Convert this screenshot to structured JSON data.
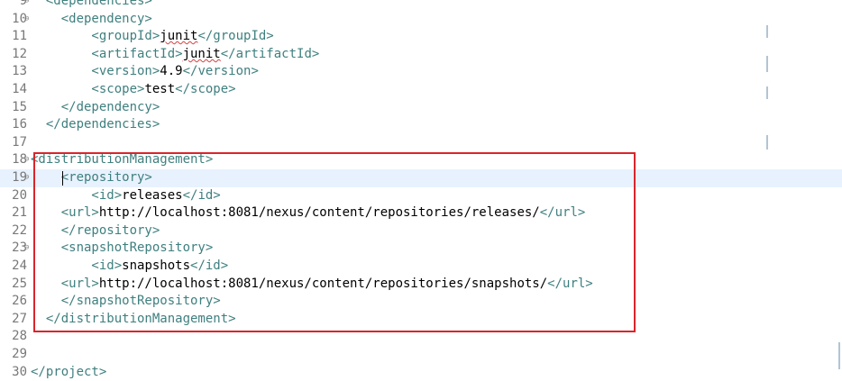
{
  "editor": {
    "lines": [
      {
        "num": "9",
        "fold": "⊖",
        "segments": [
          {
            "t": "tag",
            "v": "  <dependencies>"
          }
        ],
        "partial": true
      },
      {
        "num": "10",
        "fold": "⊖",
        "segments": [
          {
            "t": "tag",
            "v": "    <dependency>"
          }
        ]
      },
      {
        "num": "11",
        "segments": [
          {
            "t": "tag",
            "v": "        <groupId>"
          },
          {
            "t": "txt",
            "v": "junit",
            "squig": true
          },
          {
            "t": "tag",
            "v": "</groupId>"
          }
        ]
      },
      {
        "num": "12",
        "segments": [
          {
            "t": "tag",
            "v": "        <artifactId>"
          },
          {
            "t": "txt",
            "v": "junit",
            "squig": true
          },
          {
            "t": "tag",
            "v": "</artifactId>"
          }
        ]
      },
      {
        "num": "13",
        "segments": [
          {
            "t": "tag",
            "v": "        <version>"
          },
          {
            "t": "txt",
            "v": "4.9"
          },
          {
            "t": "tag",
            "v": "</version>"
          }
        ]
      },
      {
        "num": "14",
        "segments": [
          {
            "t": "tag",
            "v": "        <scope>"
          },
          {
            "t": "txt",
            "v": "test"
          },
          {
            "t": "tag",
            "v": "</scope>"
          }
        ]
      },
      {
        "num": "15",
        "segments": [
          {
            "t": "tag",
            "v": "    </dependency>"
          }
        ]
      },
      {
        "num": "16",
        "segments": [
          {
            "t": "tag",
            "v": "  </dependencies>"
          }
        ]
      },
      {
        "num": "17",
        "segments": []
      },
      {
        "num": "18",
        "fold": "⊖",
        "segments": [
          {
            "t": "tag",
            "v": "<distributionManagement>"
          }
        ]
      },
      {
        "num": "19",
        "fold": "⊖",
        "current": true,
        "segments": [
          {
            "t": "tag",
            "v": "    <repository>"
          }
        ]
      },
      {
        "num": "20",
        "segments": [
          {
            "t": "tag",
            "v": "        <id>"
          },
          {
            "t": "txt",
            "v": "releases"
          },
          {
            "t": "tag",
            "v": "</id>"
          }
        ]
      },
      {
        "num": "21",
        "segments": [
          {
            "t": "tag",
            "v": "    <url>"
          },
          {
            "t": "txt",
            "v": "http://localhost:8081/nexus/content/repositories/releases/"
          },
          {
            "t": "tag",
            "v": "</url>"
          }
        ]
      },
      {
        "num": "22",
        "segments": [
          {
            "t": "tag",
            "v": "    </repository>"
          }
        ]
      },
      {
        "num": "23",
        "fold": "⊖",
        "segments": [
          {
            "t": "tag",
            "v": "    <snapshotRepository>"
          }
        ]
      },
      {
        "num": "24",
        "segments": [
          {
            "t": "tag",
            "v": "        <id>"
          },
          {
            "t": "txt",
            "v": "snapshots"
          },
          {
            "t": "tag",
            "v": "</id>"
          }
        ]
      },
      {
        "num": "25",
        "segments": [
          {
            "t": "tag",
            "v": "    <url>"
          },
          {
            "t": "txt",
            "v": "http://localhost:8081/nexus/content/repositories/snapshots/"
          },
          {
            "t": "tag",
            "v": "</url>"
          }
        ]
      },
      {
        "num": "26",
        "segments": [
          {
            "t": "tag",
            "v": "    </snapshotRepository>"
          }
        ]
      },
      {
        "num": "27",
        "segments": [
          {
            "t": "tag",
            "v": "  </distributionManagement>"
          }
        ]
      },
      {
        "num": "28",
        "segments": []
      },
      {
        "num": "29",
        "segments": []
      },
      {
        "num": "30",
        "segments": [
          {
            "t": "tag",
            "v": "</project>"
          }
        ]
      }
    ]
  },
  "colors": {
    "tag": "#3f7f7f",
    "text": "#000000",
    "line_number": "#787878",
    "current_line": "#e8f2fe",
    "annotation_box": "#d9252b"
  }
}
